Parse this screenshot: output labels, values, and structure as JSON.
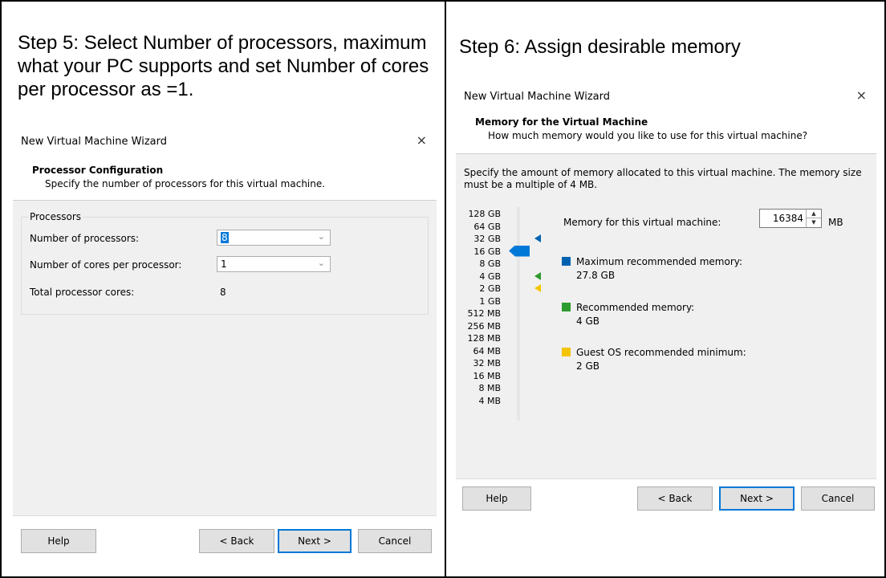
{
  "left": {
    "step_title": "Step 5: Select Number of processors, maximum what your PC supports and set Number of cores per processor as =1.",
    "dialog": {
      "window_title": "New Virtual Machine Wizard",
      "close_glyph": "×",
      "header_title": "Processor Configuration",
      "header_subtitle": "Specify the number of processors for this virtual machine.",
      "group_label": "Processors",
      "rows": {
        "processors_label": "Number of processors:",
        "processors_value": "8",
        "cores_label": "Number of cores per processor:",
        "cores_value": "1",
        "total_label": "Total processor cores:",
        "total_value": "8"
      },
      "buttons": {
        "help": "Help",
        "back": "< Back",
        "next": "Next >",
        "cancel": "Cancel"
      }
    }
  },
  "right": {
    "step_title": "Step 6: Assign desirable memory",
    "dialog": {
      "window_title": "New Virtual Machine Wizard",
      "close_glyph": "×",
      "header_title": "Memory for the Virtual Machine",
      "header_subtitle": "How much memory would you like to use for this virtual machine?",
      "description": "Specify the amount of memory allocated to this virtual machine. The memory size must be a multiple of 4 MB.",
      "scale_labels": [
        "128 GB",
        "64 GB",
        "32 GB",
        "16 GB",
        "8 GB",
        "4 GB",
        "2 GB",
        "1 GB",
        "512 MB",
        "256 MB",
        "128 MB",
        "64 MB",
        "32 MB",
        "16 MB",
        "8 MB",
        "4 MB"
      ],
      "memory_label": "Memory for this virtual machine:",
      "memory_value": "16384",
      "memory_unit": "MB",
      "selected_scale_index": 3,
      "max_recommended_index": 2,
      "recommended_index": 5,
      "guest_min_index": 6,
      "legend": {
        "max_label": "Maximum recommended memory:",
        "max_value": "27.8 GB",
        "rec_label": "Recommended memory:",
        "rec_value": "4 GB",
        "min_label": "Guest OS recommended minimum:",
        "min_value": "2 GB"
      },
      "colors": {
        "max": "#0063b1",
        "rec": "#2e9b2e",
        "min": "#f5c400",
        "thumb": "#0078d7"
      },
      "buttons": {
        "help": "Help",
        "back": "< Back",
        "next": "Next >",
        "cancel": "Cancel"
      }
    }
  }
}
